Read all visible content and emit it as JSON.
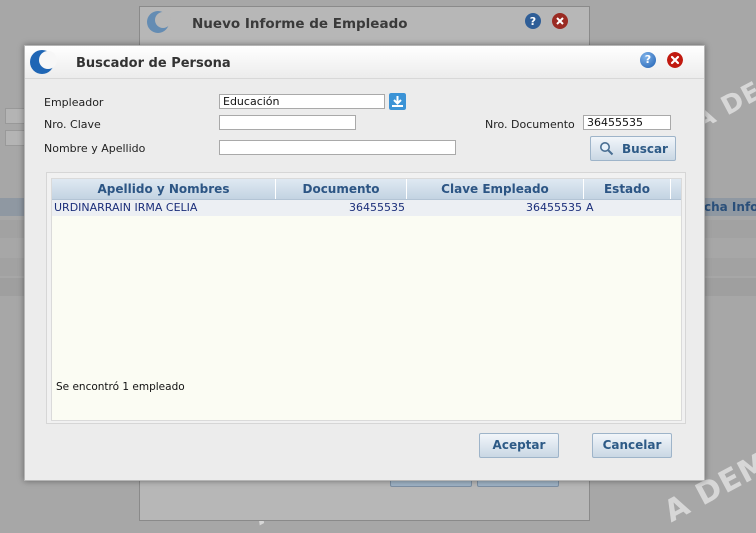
{
  "background_dialog": {
    "title": "Nuevo Informe de Empleado"
  },
  "background_app": {
    "column_header_fragment": "cha Info",
    "watermark_fragment": "A DEM"
  },
  "dialog": {
    "title": "Buscador de Persona",
    "fields": {
      "empleador_label": "Empleador",
      "empleador_value": "Educación",
      "clave_label": "Nro. Clave",
      "clave_value": "",
      "documento_label": "Nro. Documento",
      "documento_value": "36455535",
      "nombre_label": "Nombre y Apellido",
      "nombre_value": ""
    },
    "search_button": "Buscar",
    "grid": {
      "columns": [
        "Apellido y Nombres",
        "Documento",
        "Clave Empleado",
        "Estado"
      ],
      "rows": [
        {
          "nombre": "URDINARRAIN IRMA CELIA",
          "documento": "36455535",
          "clave": "36455535",
          "estado": "A"
        }
      ],
      "status_text": "Se encontró 1 empleado"
    },
    "accept_button": "Aceptar",
    "cancel_button": "Cancelar"
  },
  "colors": {
    "accent": "#2c5584",
    "row_text": "#1b2e7a",
    "close": "#b1140a",
    "help": "#1f5fb1"
  },
  "icons": [
    "logo-icon",
    "help-icon",
    "close-icon",
    "download-icon",
    "search-icon"
  ]
}
